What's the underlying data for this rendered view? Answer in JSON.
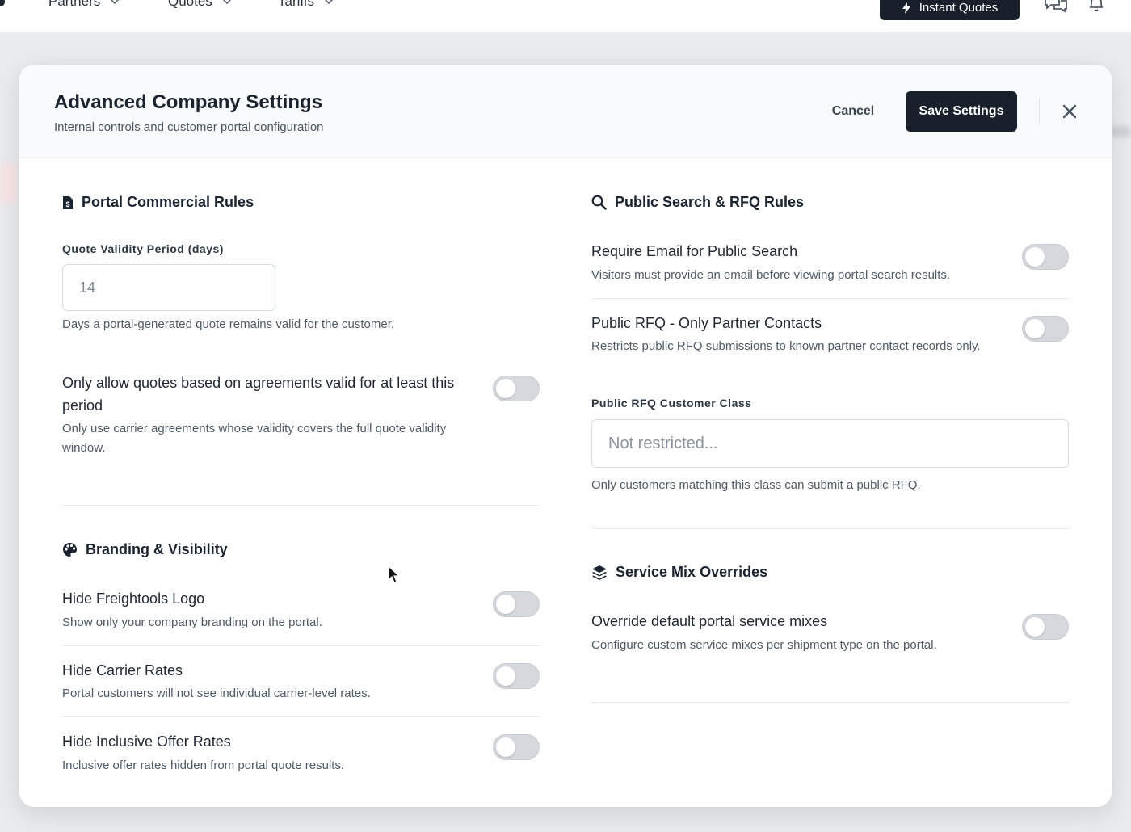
{
  "topnav": {
    "items": [
      {
        "label": "Partners"
      },
      {
        "label": "Quotes"
      },
      {
        "label": "Tariffs"
      }
    ],
    "instant_quotes_label": "Instant Quotes",
    "icons": [
      "bolt-icon",
      "chat-icon",
      "bell-icon"
    ]
  },
  "modal": {
    "title": "Advanced Company Settings",
    "subtitle": "Internal controls and customer portal configuration",
    "cancel_label": "Cancel",
    "save_label": "Save Settings"
  },
  "portal_rules": {
    "title": "Portal Commercial Rules",
    "validity_label": "Quote Validity Period (days)",
    "validity_value": "14",
    "validity_help": "Days a portal-generated quote remains valid for the customer.",
    "agreements_label": "Only allow quotes based on agreements valid for at least this period",
    "agreements_desc": "Only use carrier agreements whose validity covers the full quote validity window.",
    "agreements_on": false
  },
  "branding": {
    "title": "Branding & Visibility",
    "settings": [
      {
        "label": "Hide Freightools Logo",
        "desc": "Show only your company branding on the portal.",
        "on": false
      },
      {
        "label": "Hide Carrier Rates",
        "desc": "Portal customers will not see individual carrier-level rates.",
        "on": false
      },
      {
        "label": "Hide Inclusive Offer Rates",
        "desc": "Inclusive offer rates hidden from portal quote results.",
        "on": false
      }
    ]
  },
  "public_search": {
    "title": "Public Search & RFQ Rules",
    "settings": [
      {
        "label": "Require Email for Public Search",
        "desc": "Visitors must provide an email before viewing portal search results.",
        "on": false
      },
      {
        "label": "Public RFQ - Only Partner Contacts",
        "desc": "Restricts public RFQ submissions to known partner contact records only.",
        "on": false
      }
    ],
    "customer_class_label": "Public RFQ Customer Class",
    "customer_class_placeholder": "Not restricted...",
    "customer_class_help": "Only customers matching this class can submit a public RFQ."
  },
  "service_mix": {
    "title": "Service Mix Overrides",
    "settings": [
      {
        "label": "Override default portal service mixes",
        "desc": "Configure custom service mixes per shipment type on the portal.",
        "on": false
      }
    ]
  },
  "colors": {
    "primary_button": "#17202b",
    "toggle_off": "#d5d9de",
    "text": "#1f2733"
  }
}
